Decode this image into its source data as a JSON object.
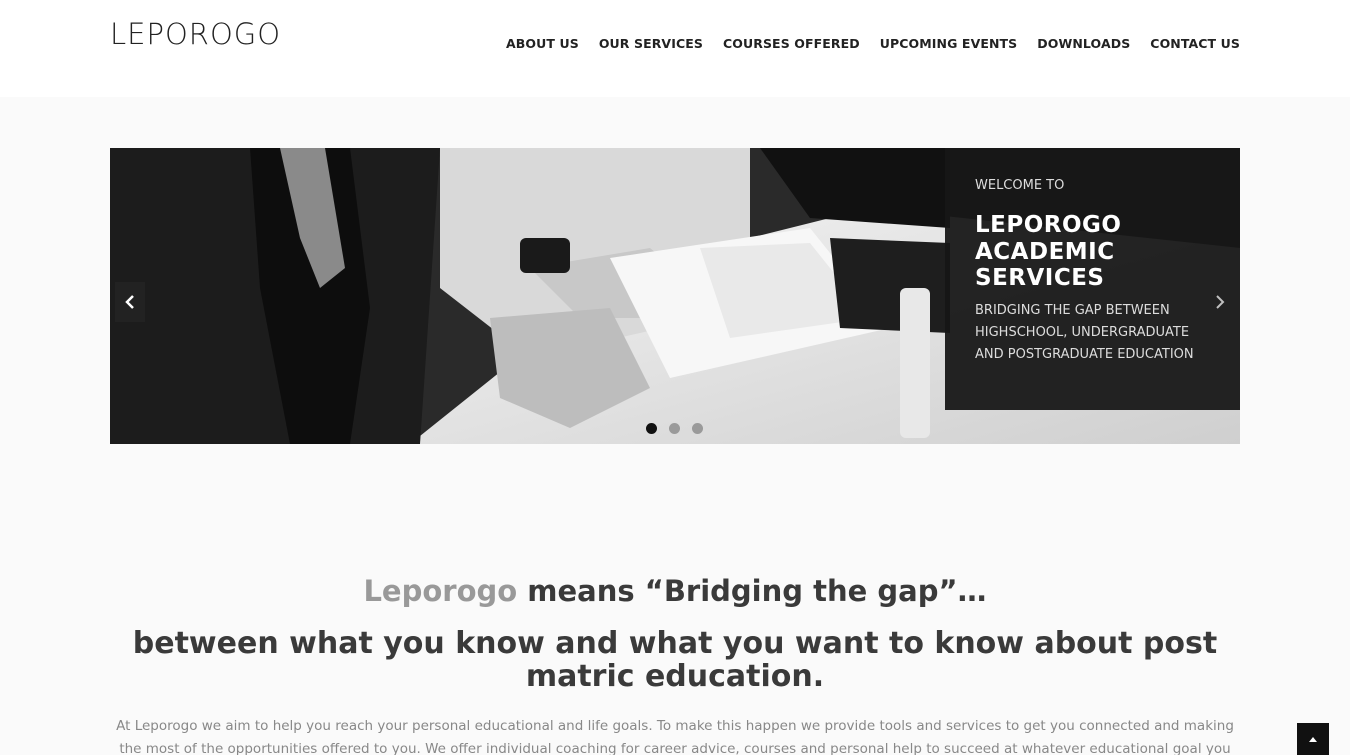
{
  "logo": {
    "text": "LEPOROGO"
  },
  "nav": {
    "items": [
      {
        "label": "ABOUT US"
      },
      {
        "label": "OUR SERVICES"
      },
      {
        "label": "COURSES OFFERED"
      },
      {
        "label": "UPCOMING EVENTS"
      },
      {
        "label": "DOWNLOADS"
      },
      {
        "label": "CONTACT US"
      }
    ]
  },
  "slider": {
    "kicker": "WELCOME TO",
    "title": "LEPOROGO ACADEMIC SERVICES",
    "subtitle": "BRIDGING THE GAP BETWEEN HIGHSCHOOL, UNDERGRADUATE AND POSTGRADUATE EDUCATION",
    "prev_icon": "chevron-left-icon",
    "next_icon": "chevron-right-icon",
    "active_slide": 1,
    "slide_count": 3
  },
  "content": {
    "headline_brand": "Leporogo",
    "headline_rest": " means “Bridging the gap”…",
    "subhead": "between what you know and what you want to know about post matric education.",
    "intro": "At Leporogo we aim to help you reach your personal educational and life goals. To make this happen we provide tools and services to get you connected and making the most of the opportunities offered to you. We offer individual coaching for career advice, courses and personal help to succeed at whatever educational goal you have set your heart on. If"
  },
  "back_to_top": {
    "icon": "chevron-up-icon"
  },
  "colors": {
    "text": "#333333",
    "brand_grey": "#999999",
    "caption_bg": "#161616",
    "page_bg": "#fafafa"
  }
}
